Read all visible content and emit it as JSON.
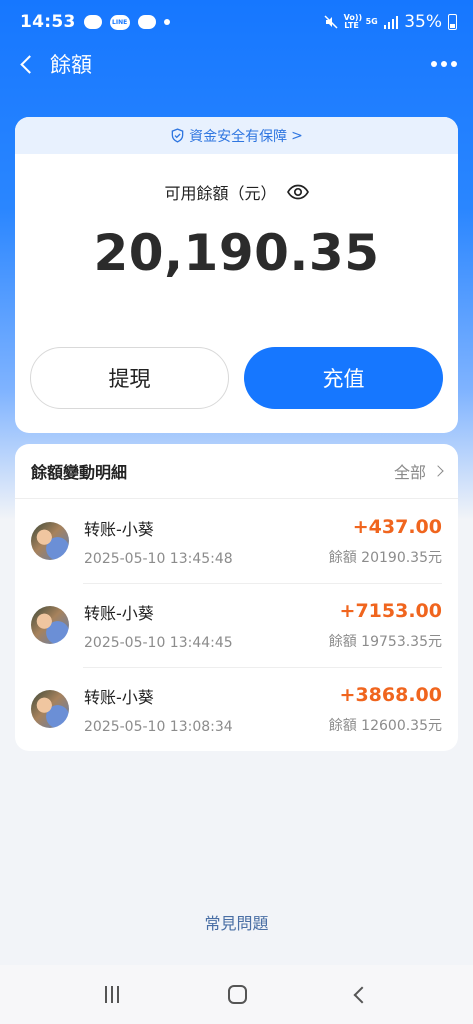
{
  "status_bar": {
    "time": "14:53",
    "line_label": "LINE",
    "volte_label": "Vo)) LTE",
    "network_label": "5G",
    "battery": "35%"
  },
  "nav": {
    "title": "餘額"
  },
  "balance_card": {
    "security_banner": "資金安全有保障",
    "banner_arrow": ">",
    "balance_label": "可用餘額（元）",
    "balance_amount": "20,190.35",
    "withdraw_label": "提現",
    "recharge_label": "充值"
  },
  "transactions": {
    "title": "餘額變動明細",
    "view_all": "全部",
    "items": [
      {
        "name": "转账-小葵",
        "time": "2025-05-10 13:45:48",
        "amount": "+437.00",
        "balance": "餘額 20190.35元"
      },
      {
        "name": "转账-小葵",
        "time": "2025-05-10 13:44:45",
        "amount": "+7153.00",
        "balance": "餘額 19753.35元"
      },
      {
        "name": "转账-小葵",
        "time": "2025-05-10 13:08:34",
        "amount": "+3868.00",
        "balance": "餘額 12600.35元"
      }
    ]
  },
  "footer": {
    "faq": "常見問題"
  },
  "colors": {
    "primary": "#1677ff",
    "amount": "#f0651e",
    "banner_bg": "#e8f1fe"
  }
}
